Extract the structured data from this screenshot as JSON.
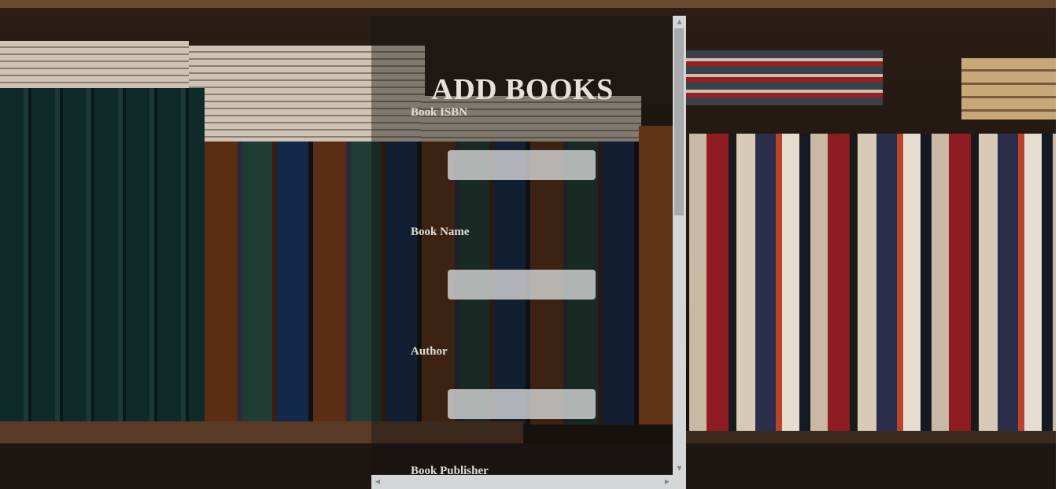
{
  "form": {
    "title": "ADD BOOKS",
    "fields": [
      {
        "label": "Book ISBN",
        "value": ""
      },
      {
        "label": "Book Name",
        "value": ""
      },
      {
        "label": "Author",
        "value": ""
      },
      {
        "label": "Book Publisher",
        "value": ""
      }
    ]
  },
  "scrollbar": {
    "up_icon": "arrow-up-icon",
    "down_icon": "arrow-down-icon",
    "left_icon": "arrow-left-icon",
    "right_icon": "arrow-right-icon"
  },
  "colors": {
    "title": "#e4e1dc",
    "field_bg": "#d2d4d4",
    "scrollbar": "#d5d6d7"
  }
}
